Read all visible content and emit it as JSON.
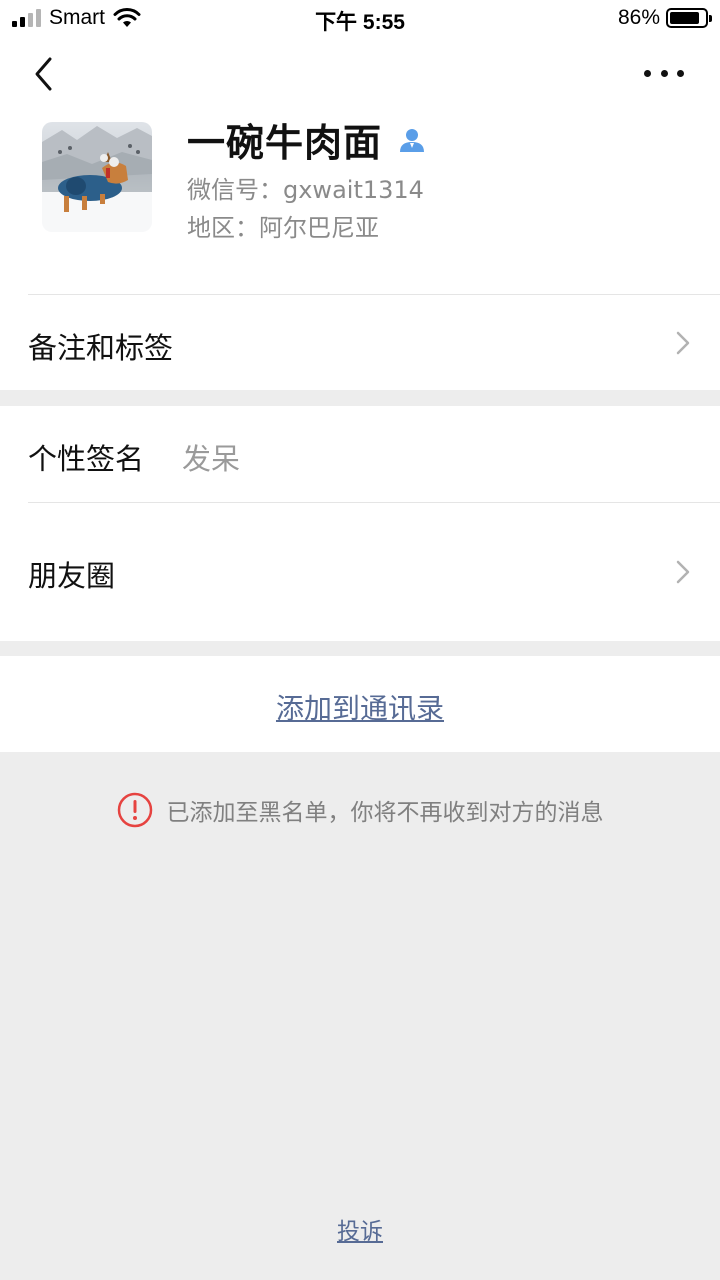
{
  "status_bar": {
    "carrier": "Smart",
    "time": "下午 5:55",
    "battery_percent": "86%",
    "battery_level": 0.86
  },
  "profile": {
    "name": "一碗牛肉面",
    "wechat_id": "微信号：gxwait1314",
    "region": "地区：阿尔巴尼亚",
    "avatar_icon": "dog-in-snow-photo",
    "contact_icon": "person-icon"
  },
  "rows": {
    "remarks_tags": "备注和标签",
    "signature_label": "个性签名",
    "signature_value": "发呆",
    "moments": "朋友圈"
  },
  "actions": {
    "add_to_contacts": "添加到通讯录",
    "complain": "投诉"
  },
  "notice": {
    "text": "已添加至黑名单，你将不再收到对方的消息"
  },
  "colors": {
    "link": "#576b95",
    "warning": "#e64340",
    "contact_icon": "#5a9ee8"
  }
}
